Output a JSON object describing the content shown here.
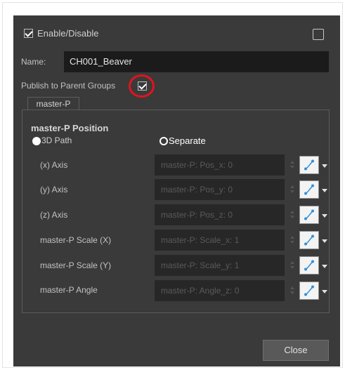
{
  "enable": {
    "label": "Enable/Disable",
    "checked": true
  },
  "corner_checkbox": {
    "checked": false
  },
  "name": {
    "label": "Name:",
    "value": "CH001_Beaver"
  },
  "publish": {
    "label": "Publish to Parent Groups",
    "checked": true
  },
  "tab": {
    "label": "master-P"
  },
  "position": {
    "title": "master-P Position",
    "radio_3d": {
      "label": "3D Path",
      "selected": false
    },
    "radio_separate": {
      "label": "Separate",
      "selected": true
    }
  },
  "fields": [
    {
      "label": "(x) Axis",
      "value": "master-P: Pos_x: 0"
    },
    {
      "label": "(y) Axis",
      "value": "master-P: Pos_y: 0"
    },
    {
      "label": "(z) Axis",
      "value": "master-P: Pos_z: 0"
    },
    {
      "label": "master-P Scale (X)",
      "value": "master-P: Scale_x: 1"
    },
    {
      "label": "master-P Scale (Y)",
      "value": "master-P: Scale_y: 1"
    },
    {
      "label": "master-P Angle",
      "value": "master-P: Angle_z: 0"
    }
  ],
  "close_button": {
    "label": "Close"
  },
  "icons": {
    "function": "function-curve-icon",
    "dropdown": "chevron-down-icon"
  },
  "colors": {
    "dialog_bg": "#3a3a3a",
    "field_bg": "#272727",
    "highlight": "#e0141e",
    "icon_blue": "#2f8fdc"
  }
}
